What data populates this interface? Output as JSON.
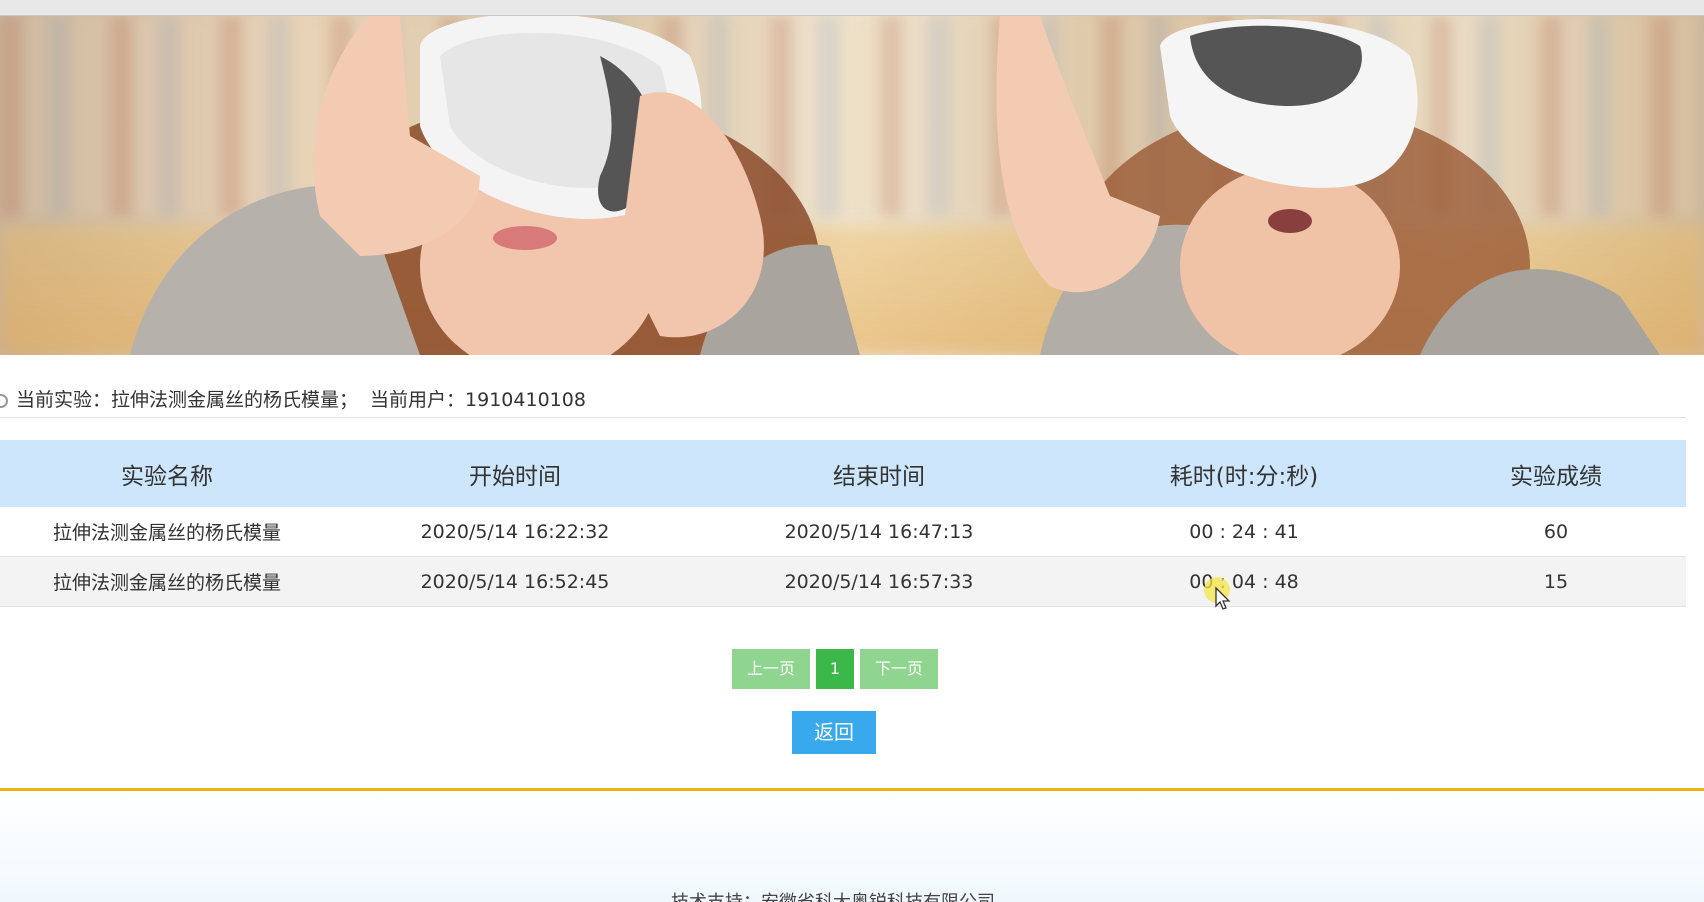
{
  "info": {
    "experiment_label": "当前实验：",
    "experiment_name": "拉伸法测金属丝的杨氏模量；",
    "user_label": "当前用户：",
    "user_id": "1910410108"
  },
  "table": {
    "headers": [
      "实验名称",
      "开始时间",
      "结束时间",
      "耗时(时:分:秒)",
      "实验成绩"
    ],
    "rows": [
      [
        "拉伸法测金属丝的杨氏模量",
        "2020/5/14 16:22:32",
        "2020/5/14 16:47:13",
        "00 : 24 : 41",
        "60"
      ],
      [
        "拉伸法测金属丝的杨氏模量",
        "2020/5/14 16:52:45",
        "2020/5/14 16:57:33",
        "00 : 04 : 48",
        "15"
      ]
    ]
  },
  "pager": {
    "prev_label": "上一页",
    "current_page": "1",
    "next_label": "下一页"
  },
  "back_label": "返回",
  "footer": {
    "text": "技术支持：安徽省科大奥锐科技有限公司"
  },
  "colors": {
    "header_bg": "#cde6fb",
    "pager_bg": "#8fd58f",
    "pager_active": "#3cb84a",
    "back_button": "#39a9ee",
    "footer_rule": "#e8b40f"
  }
}
